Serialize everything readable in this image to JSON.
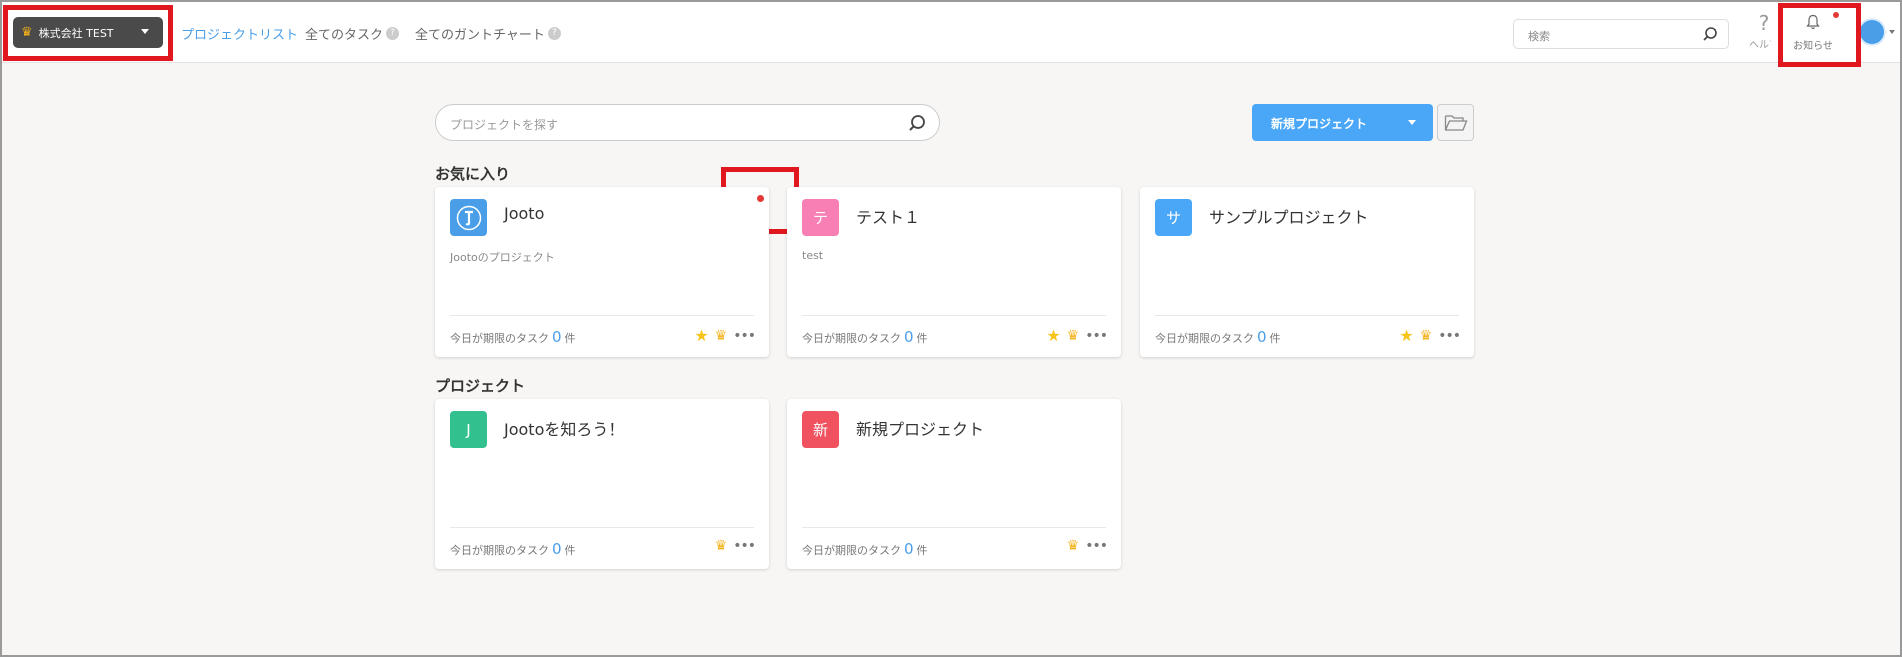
{
  "header": {
    "org_name": "株式会社 TEST",
    "nav": [
      {
        "label": "プロジェクトリスト",
        "active": true
      },
      {
        "label": "全てのタスク",
        "help": "?"
      },
      {
        "label": "全てのガントチャート",
        "help": "?"
      }
    ],
    "search_placeholder": "検索",
    "help_label": "ヘルプ",
    "help_glyph": "?",
    "notice_label": "お知らせ"
  },
  "main": {
    "search_placeholder": "プロジェクトを探す",
    "new_project_label": "新規プロジェクト",
    "favorites_title": "お気に入り",
    "projects_title": "プロジェクト",
    "due_prefix": "今日が期限のタスク",
    "due_suffix": "件",
    "favorites": [
      {
        "initial": "",
        "name": "Jooto",
        "desc": "Jootoのプロジェクト",
        "due": "0",
        "color": "#4a9ee8"
      },
      {
        "initial": "テ",
        "name": "テスト１",
        "desc": "test",
        "due": "0",
        "color": "#f77fb3"
      },
      {
        "initial": "サ",
        "name": "サンプルプロジェクト",
        "desc": "",
        "due": "0",
        "color": "#4aa7f7"
      }
    ],
    "projects": [
      {
        "initial": "J",
        "name": "Jootoを知ろう！",
        "desc": "",
        "due": "0",
        "color": "#33c08f"
      },
      {
        "initial": "新",
        "name": "新規プロジェクト",
        "desc": "",
        "due": "0",
        "color": "#f0525f"
      }
    ]
  },
  "colors": {
    "accent": "#4aa7f7",
    "highlight": "#e0171f",
    "crown": "#f5b21b",
    "star": "#f5c518"
  }
}
